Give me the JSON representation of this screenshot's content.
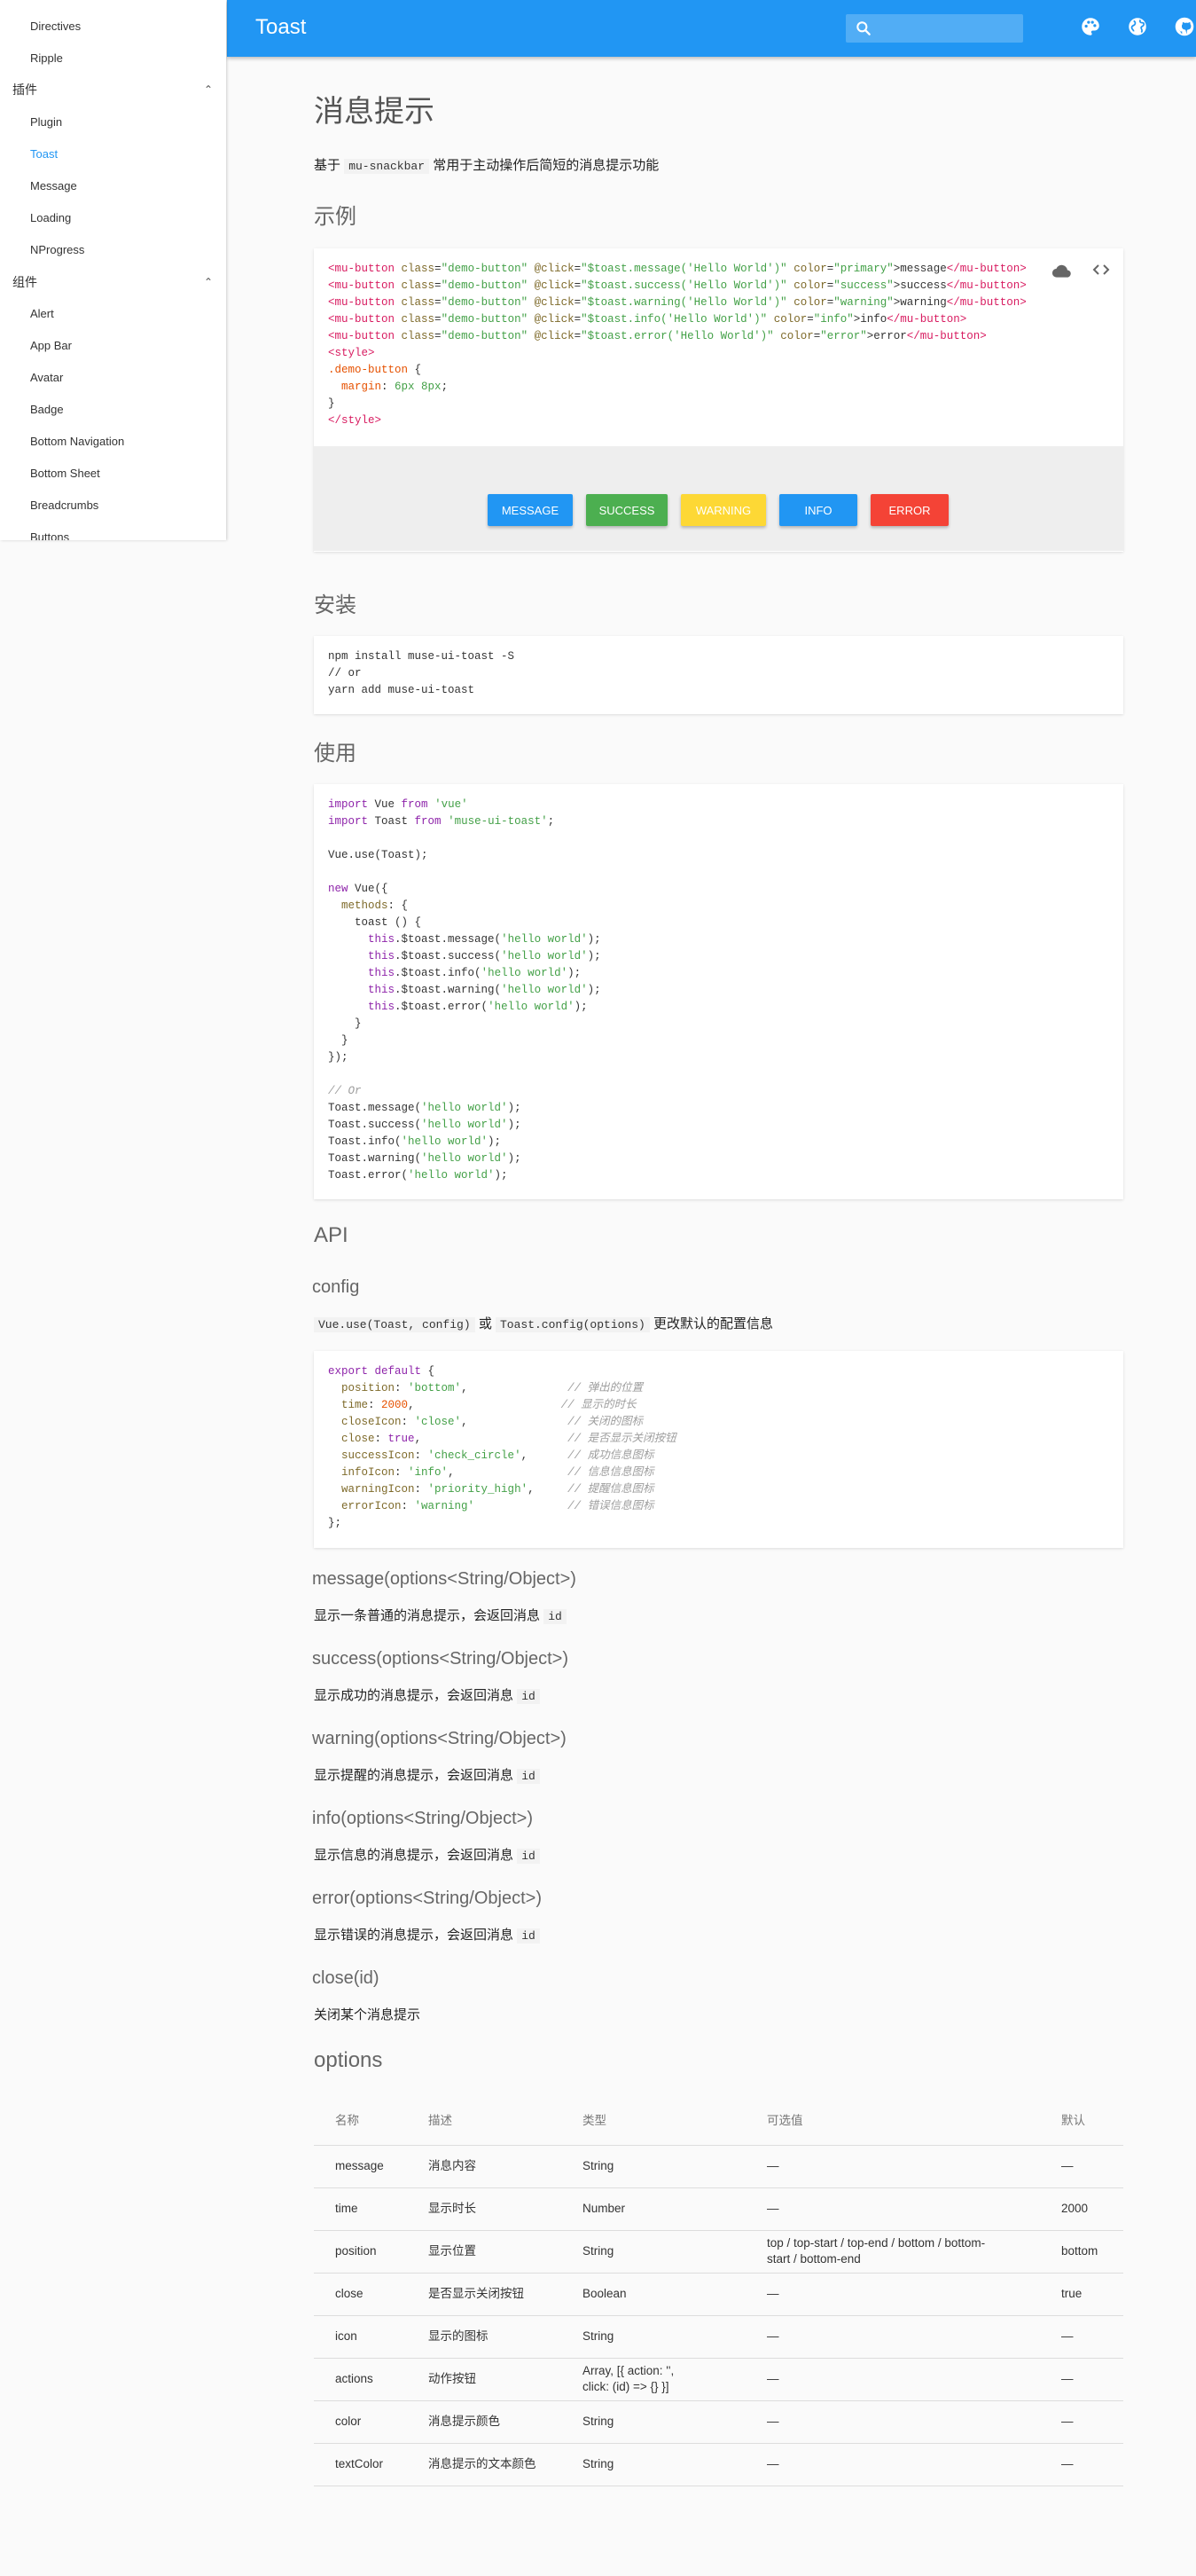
{
  "sidebar": {
    "items": [
      {
        "label": "Directives",
        "type": "item"
      },
      {
        "label": "Ripple",
        "type": "item"
      },
      {
        "label": "插件",
        "type": "group"
      },
      {
        "label": "Plugin",
        "type": "item"
      },
      {
        "label": "Toast",
        "type": "item",
        "active": true
      },
      {
        "label": "Message",
        "type": "item"
      },
      {
        "label": "Loading",
        "type": "item"
      },
      {
        "label": "NProgress",
        "type": "item"
      },
      {
        "label": "组件",
        "type": "group"
      },
      {
        "label": "Alert",
        "type": "item"
      },
      {
        "label": "App Bar",
        "type": "item"
      },
      {
        "label": "Avatar",
        "type": "item"
      },
      {
        "label": "Badge",
        "type": "item"
      },
      {
        "label": "Bottom Navigation",
        "type": "item"
      },
      {
        "label": "Bottom Sheet",
        "type": "item"
      },
      {
        "label": "Breadcrumbs",
        "type": "item"
      },
      {
        "label": "Buttons",
        "type": "item"
      }
    ]
  },
  "appbar": {
    "title": "Toast",
    "search_placeholder": "",
    "icons": [
      "search-icon",
      "palette-icon",
      "language-icon",
      "github-icon"
    ],
    "color": "#2196f3"
  },
  "page": {
    "title": "消息提示",
    "intro_prefix": "基于",
    "intro_code": "mu-snackbar",
    "intro_suffix": "常用于主动操作后简短的消息提示功能",
    "example_heading": "示例",
    "install_heading": "安装",
    "usage_heading": "使用",
    "api_heading": "API",
    "config_heading": "config",
    "config_code1": "Vue.use(Toast, config)",
    "config_or": "或",
    "config_code2": "Toast.config(options)",
    "config_suffix": "更改默认的配置信息",
    "options_heading": "options"
  },
  "demo": {
    "buttons": [
      {
        "label": "message",
        "color": "#2196f3"
      },
      {
        "label": "success",
        "color": "#4caf50"
      },
      {
        "label": "warning",
        "color": "#fdd835"
      },
      {
        "label": "info",
        "color": "#2196f3"
      },
      {
        "label": "error",
        "color": "#f44336"
      }
    ],
    "code_icons": [
      "cloud-icon",
      "code-icon"
    ]
  },
  "install_code": [
    "npm install muse-ui-toast -S",
    "// or",
    "yarn add muse-ui-toast"
  ],
  "methods": [
    {
      "name": "message(options<String/Object>)",
      "desc": "显示一条普通的消息提示，会返回消息",
      "code": "id"
    },
    {
      "name": "success(options<String/Object>)",
      "desc": "显示成功的消息提示，会返回消息",
      "code": "id"
    },
    {
      "name": "warning(options<String/Object>)",
      "desc": "显示提醒的消息提示，会返回消息",
      "code": "id"
    },
    {
      "name": "info(options<String/Object>)",
      "desc": "显示信息的消息提示，会返回消息",
      "code": "id"
    },
    {
      "name": "error(options<String/Object>)",
      "desc": "显示错误的消息提示，会返回消息",
      "code": "id"
    },
    {
      "name": "close(id)",
      "desc": "关闭某个消息提示",
      "code": ""
    }
  ],
  "options_table": {
    "headers": [
      "名称",
      "描述",
      "类型",
      "可选值",
      "默认"
    ],
    "rows": [
      [
        "message",
        "消息内容",
        "String",
        "—",
        "—"
      ],
      [
        "time",
        "显示时长",
        "Number",
        "—",
        "2000"
      ],
      [
        "position",
        "显示位置",
        "String",
        "top / top-start / top-end / bottom / bottom-start / bottom-end",
        "bottom"
      ],
      [
        "close",
        "是否显示关闭按钮",
        "Boolean",
        "—",
        "true"
      ],
      [
        "icon",
        "显示的图标",
        "String",
        "—",
        "—"
      ],
      [
        "actions",
        "动作按钮",
        "Array, [{ action: '', click: (id) => {} }]",
        "—",
        "—"
      ],
      [
        "color",
        "消息提示颜色",
        "String",
        "—",
        "—"
      ],
      [
        "textColor",
        "消息提示的文本颜色",
        "String",
        "—",
        "—"
      ]
    ]
  }
}
